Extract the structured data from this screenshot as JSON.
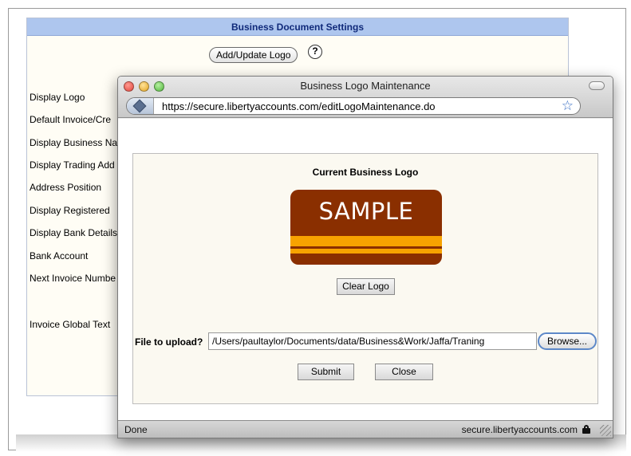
{
  "settings": {
    "title": "Business Document Settings",
    "add_logo_label": "Add/Update Logo",
    "help_symbol": "?",
    "labels": [
      "Display Logo",
      "Default Invoice/Cre",
      "Display Business Na",
      "Display Trading Add",
      "Address Position",
      "Display Registered",
      "Display Bank Details",
      "Bank Account",
      "Next Invoice Numbe",
      "Invoice Global Text"
    ]
  },
  "popup": {
    "title": "Business Logo Maintenance",
    "url": "https://secure.libertyaccounts.com/editLogoMaintenance.do",
    "logo_heading": "Current Business Logo",
    "sample_text": "SAMPLE",
    "clear_logo_label": "Clear Logo",
    "upload_label": "File to upload?",
    "file_value": "/Users/paultaylor/Documents/data/Business&Work/Jaffa/Traning",
    "browse_label": "Browse...",
    "submit_label": "Submit",
    "close_label": "Close",
    "status_left": "Done",
    "status_right": "secure.libertyaccounts.com",
    "colors": {
      "logo_background": "#8a2f00",
      "logo_stripe": "#f7a300",
      "header_blue": "#aec6ee"
    }
  }
}
